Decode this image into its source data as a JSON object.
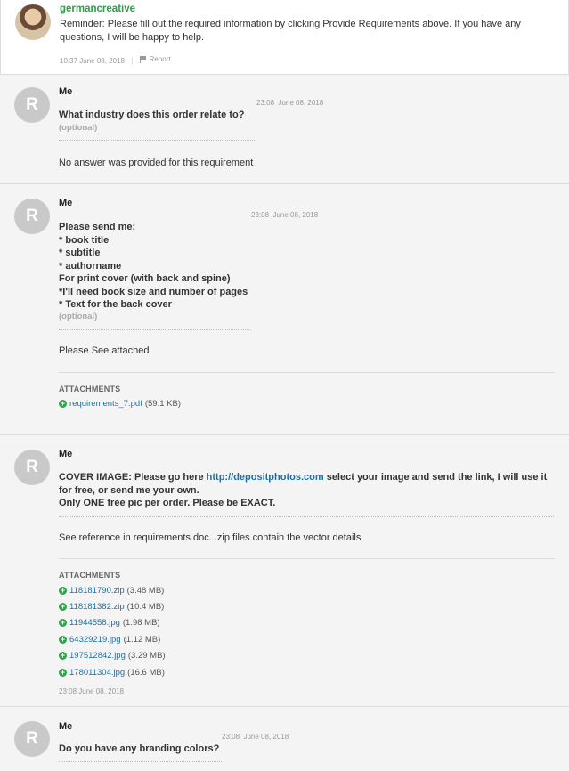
{
  "messages": [
    {
      "sender": "germancreative",
      "text": "Reminder: Please fill out the required information by clicking Provide Requirements above. If you have any questions, I will be happy to help.",
      "time": "10:37",
      "date": "June 08, 2018",
      "report_label": "Report"
    },
    {
      "avatar": "R",
      "sender": "Me",
      "time": "23:08",
      "date": "June 08, 2018",
      "question": "What industry does this order relate to?",
      "optional": "(optional)",
      "answer": "No answer was provided for this requirement"
    },
    {
      "avatar": "R",
      "sender": "Me",
      "time": "23:08",
      "date": "June 08, 2018",
      "question_lines": [
        "Please send me:",
        "* book title",
        "* subtitle",
        "* authorname",
        "For print cover (with back and spine)",
        "*I'll need book size and number of pages",
        "* Text for the back cover"
      ],
      "optional": "(optional)",
      "answer": "Please See attached",
      "attachments_title": "ATTACHMENTS",
      "attachments": [
        {
          "name": "requirements_7.pdf",
          "size": "(59.1 KB)"
        }
      ]
    },
    {
      "avatar": "R",
      "sender": "Me",
      "question_pre": "COVER IMAGE: Please go here ",
      "question_link": "http://depositphotos.com",
      "question_post": " select your image and send the link, I will use it for free, or send me your own.",
      "question_line2": "Only ONE free pic per order. Please be EXACT.",
      "answer": "See reference in requirements doc. .zip files contain the vector details",
      "attachments_title": "ATTACHMENTS",
      "attachments": [
        {
          "name": "118181790.zip",
          "size": "(3.48 MB)"
        },
        {
          "name": "118181382.zip",
          "size": "(10.4 MB)"
        },
        {
          "name": "11944558.jpg",
          "size": "(1.98 MB)"
        },
        {
          "name": "64329219.jpg",
          "size": "(1.12 MB)"
        },
        {
          "name": "197512842.jpg",
          "size": "(3.29 MB)"
        },
        {
          "name": "178011304.jpg",
          "size": "(16.6 MB)"
        }
      ],
      "time": "23:08",
      "date": "June 08, 2018"
    },
    {
      "avatar": "R",
      "sender": "Me",
      "time": "23:08",
      "date": "June 08, 2018",
      "question": "Do you have any branding colors?"
    }
  ],
  "colors": {
    "seller_name": "#27a143",
    "link": "#1f6fa3",
    "attach_icon": "#2aa748"
  },
  "icons": {
    "attach": "plus-circle-icon",
    "report": "flag-icon"
  }
}
